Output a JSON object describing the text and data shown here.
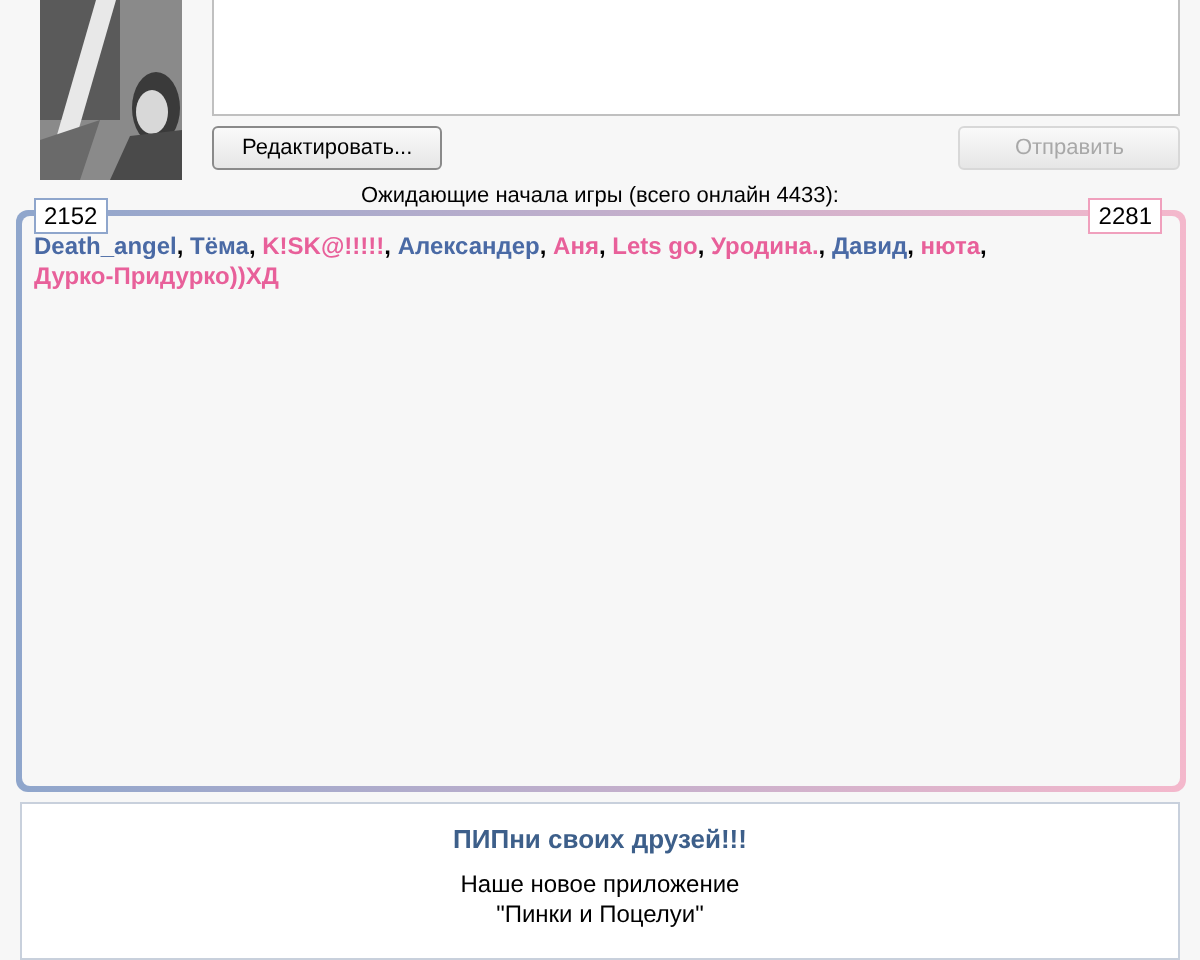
{
  "composer": {
    "edit_button": "Редактировать...",
    "send_button": {
      "label": "Отправить",
      "disabled": true
    }
  },
  "waiting": {
    "caption": "Ожидающие начала игры (всего онлайн 4433):",
    "counters": [
      {
        "value": "2152",
        "color": "#8fa6cc"
      },
      {
        "value": "2281",
        "color": "#f0a0bd"
      }
    ],
    "separator": ",",
    "players": [
      {
        "name": "Death_angel",
        "color": "#4a6aa5"
      },
      {
        "name": "Тёма",
        "color": "#4a6aa5"
      },
      {
        "name": "K!SK@!!!!!",
        "color": "#e8609a"
      },
      {
        "name": "Александер",
        "color": "#4a6aa5"
      },
      {
        "name": "Аня",
        "color": "#e8609a"
      },
      {
        "name": "Lets go",
        "color": "#e8609a"
      },
      {
        "name": "Уродина.",
        "color": "#e8609a"
      },
      {
        "name": "Давид",
        "color": "#4a6aa5"
      },
      {
        "name": "нюта",
        "color": "#e8609a"
      },
      {
        "name": "Дурко-Придурко))ХД",
        "color": "#e8609a"
      }
    ]
  },
  "promo": {
    "title": "ПИПни своих друзей!!!",
    "lines": [
      "Наше новое приложение",
      "\"Пинки и Поцелуи\""
    ]
  }
}
